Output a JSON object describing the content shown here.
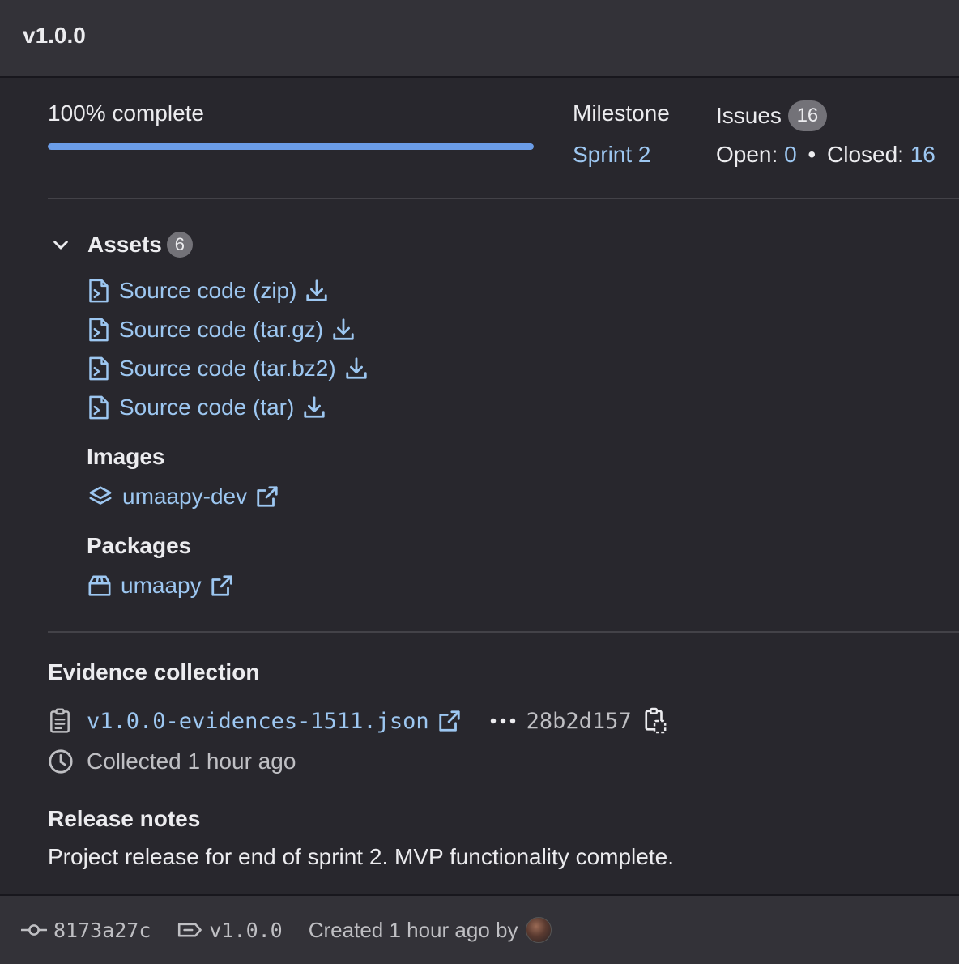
{
  "header": {
    "title": "v1.0.0"
  },
  "progress": {
    "label": "100% complete",
    "value": 100
  },
  "milestone": {
    "heading": "Milestone",
    "name": "Sprint 2"
  },
  "issues": {
    "heading": "Issues",
    "count": "16",
    "open_label": "Open:",
    "open_count": "0",
    "separator": "•",
    "closed_label": "Closed:",
    "closed_count": "16"
  },
  "assets": {
    "heading": "Assets",
    "count": "6",
    "sources": [
      {
        "label": "Source code (zip)"
      },
      {
        "label": "Source code (tar.gz)"
      },
      {
        "label": "Source code (tar.bz2)"
      },
      {
        "label": "Source code (tar)"
      }
    ],
    "images_heading": "Images",
    "images": [
      {
        "label": "umaapy-dev"
      }
    ],
    "packages_heading": "Packages",
    "packages": [
      {
        "label": "umaapy"
      }
    ]
  },
  "evidence": {
    "heading": "Evidence collection",
    "file": "v1.0.0-evidences-1511.json",
    "sha": "28b2d157",
    "collected": "Collected 1 hour ago"
  },
  "release_notes": {
    "heading": "Release notes",
    "text": "Project release for end of sprint 2. MVP functionality complete."
  },
  "footer": {
    "commit": "8173a27c",
    "tag": "v1.0.0",
    "created": "Created 1 hour ago by"
  },
  "colors": {
    "link": "#9dc7f1",
    "progress": "#6b9de8",
    "background": "#28272d",
    "header": "#333238"
  }
}
